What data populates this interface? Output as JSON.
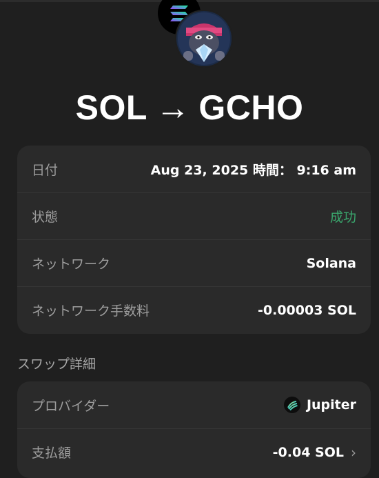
{
  "header": {
    "from_token": "SOL",
    "arrow": "→",
    "to_token": "GCHO"
  },
  "details": {
    "rows": [
      {
        "label": "日付",
        "value": "Aug 23, 2025 時間： 9:16 am"
      },
      {
        "label": "状態",
        "value": "成功"
      },
      {
        "label": "ネットワーク",
        "value": "Solana"
      },
      {
        "label": "ネットワーク手数料",
        "value": "-0.00003 SOL"
      }
    ]
  },
  "swap": {
    "heading": "スワップ詳細",
    "rows": [
      {
        "label": "プロバイダー",
        "value": "Jupiter"
      },
      {
        "label": "支払額",
        "value": "-0.04 SOL"
      }
    ]
  },
  "colors": {
    "background": "#1f1f1f",
    "card": "#2a2a2a",
    "success": "#3aa76d",
    "muted": "#9d9d9d"
  },
  "icons": {
    "from_token": "solana-logo",
    "to_token": "gcho-gorilla-logo",
    "provider": "jupiter-logo",
    "chevron": "chevron-right-icon"
  }
}
